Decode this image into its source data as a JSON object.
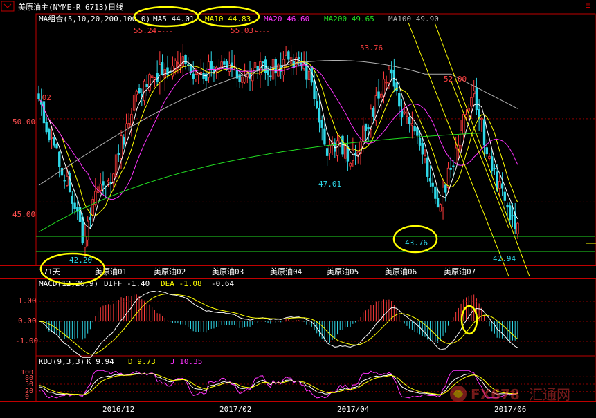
{
  "title": "美原油主(NYME-R 6713)日线",
  "colors": {
    "up": "#ff3b3b",
    "down": "#2fd8e8",
    "ma5": "#ffffff",
    "ma10": "#ffff00",
    "ma20": "#ff33ff",
    "ma200": "#22dd22",
    "ma100": "#b0b0b0",
    "grid": "#8b0000",
    "axis": "#c00000",
    "highlight": "#ffff00",
    "peak_label": "#ff4040",
    "trough_label": "#2fd8e8"
  },
  "price_panel": {
    "ma_legend": [
      {
        "label": "MA组合(5,10,20,200,100,0)",
        "color": "#ffffff"
      },
      {
        "label": "MA5 44.01",
        "color": "#ffffff"
      },
      {
        "label": "MA10 44.83",
        "color": "#ffff00"
      },
      {
        "label": "MA20 46.60",
        "color": "#ff33ff"
      },
      {
        "label": "MA200 49.65",
        "color": "#22dd22"
      },
      {
        "label": "MA100 49.90",
        "color": "#b0b0b0"
      }
    ],
    "y_ticks": [
      "50.00",
      "45.00"
    ],
    "partial_label": ".02",
    "range_label": "171天",
    "contracts": [
      "美原油01",
      "美原油02",
      "美原油03",
      "美原油04",
      "美原油05",
      "美原油06",
      "美原油07"
    ],
    "annotations": [
      {
        "text": "55.24",
        "kind": "peak"
      },
      {
        "text": "55.03",
        "kind": "peak"
      },
      {
        "text": "53.76",
        "kind": "peak"
      },
      {
        "text": "52.00",
        "kind": "peak"
      },
      {
        "text": "47.01",
        "kind": "trough"
      },
      {
        "text": "43.76",
        "kind": "trough"
      },
      {
        "text": "42.94",
        "kind": "trough"
      },
      {
        "text": "42.20",
        "kind": "trough"
      }
    ]
  },
  "macd_panel": {
    "legend": [
      {
        "label": "MACD(12,26,9)",
        "color": "#ffffff"
      },
      {
        "label": "DIFF -1.40",
        "color": "#ffffff"
      },
      {
        "label": "DEA -1.08",
        "color": "#ffff00"
      },
      {
        "label": "-0.64",
        "color": "#ffffff"
      }
    ],
    "y_ticks": [
      "1.00",
      "0.00",
      "-1.00"
    ]
  },
  "kdj_panel": {
    "legend": [
      {
        "label": "KDJ(9,3,3)",
        "color": "#ffffff"
      },
      {
        "label": "K 9.94",
        "color": "#ffffff"
      },
      {
        "label": "D 9.73",
        "color": "#ffff00"
      },
      {
        "label": "J 10.35",
        "color": "#ff33ff"
      }
    ],
    "y_ticks": [
      "100",
      "80",
      "50",
      "20",
      "0"
    ]
  },
  "x_axis_dates": [
    "2016/12",
    "2017/02",
    "2017/04",
    "2017/06"
  ],
  "watermark": {
    "brand": "FX678",
    "cn": "汇通网"
  },
  "chart_data": {
    "type": "candlestick",
    "title": "美原油主(NYME-R 6713)日线",
    "x_ticks": [
      "2016/12",
      "2017/02",
      "2017/04",
      "2017/06"
    ],
    "y_ticks": [
      45.0,
      50.0
    ],
    "ylim": [
      41.2,
      56.3
    ],
    "close_anchors": [
      {
        "i": 0,
        "v": 50.8
      },
      {
        "i": 6,
        "v": 48.5
      },
      {
        "i": 12,
        "v": 45.5
      },
      {
        "i": 17,
        "v": 43.0
      },
      {
        "i": 22,
        "v": 45.3
      },
      {
        "i": 27,
        "v": 46.0
      },
      {
        "i": 32,
        "v": 48.5
      },
      {
        "i": 38,
        "v": 51.5
      },
      {
        "i": 44,
        "v": 52.6
      },
      {
        "i": 50,
        "v": 53.0
      },
      {
        "i": 56,
        "v": 53.8
      },
      {
        "i": 62,
        "v": 52.4
      },
      {
        "i": 68,
        "v": 53.1
      },
      {
        "i": 74,
        "v": 52.8
      },
      {
        "i": 80,
        "v": 52.5
      },
      {
        "i": 86,
        "v": 53.3
      },
      {
        "i": 92,
        "v": 53.0
      },
      {
        "i": 98,
        "v": 53.6
      },
      {
        "i": 104,
        "v": 52.8
      },
      {
        "i": 108,
        "v": 51.0
      },
      {
        "i": 112,
        "v": 48.0
      },
      {
        "i": 117,
        "v": 48.5
      },
      {
        "i": 121,
        "v": 47.5
      },
      {
        "i": 125,
        "v": 48.8
      },
      {
        "i": 130,
        "v": 50.5
      },
      {
        "i": 134,
        "v": 52.5
      },
      {
        "i": 137,
        "v": 53.2
      },
      {
        "i": 140,
        "v": 51.0
      },
      {
        "i": 144,
        "v": 49.5
      },
      {
        "i": 148,
        "v": 48.5
      },
      {
        "i": 152,
        "v": 46.0
      },
      {
        "i": 155,
        "v": 45.0
      },
      {
        "i": 159,
        "v": 46.5
      },
      {
        "i": 163,
        "v": 48.5
      },
      {
        "i": 166,
        "v": 50.5
      },
      {
        "i": 169,
        "v": 51.6
      },
      {
        "i": 172,
        "v": 49.5
      },
      {
        "i": 176,
        "v": 47.0
      },
      {
        "i": 180,
        "v": 45.5
      },
      {
        "i": 184,
        "v": 43.8
      },
      {
        "i": 186,
        "v": 43.3
      }
    ]
  }
}
